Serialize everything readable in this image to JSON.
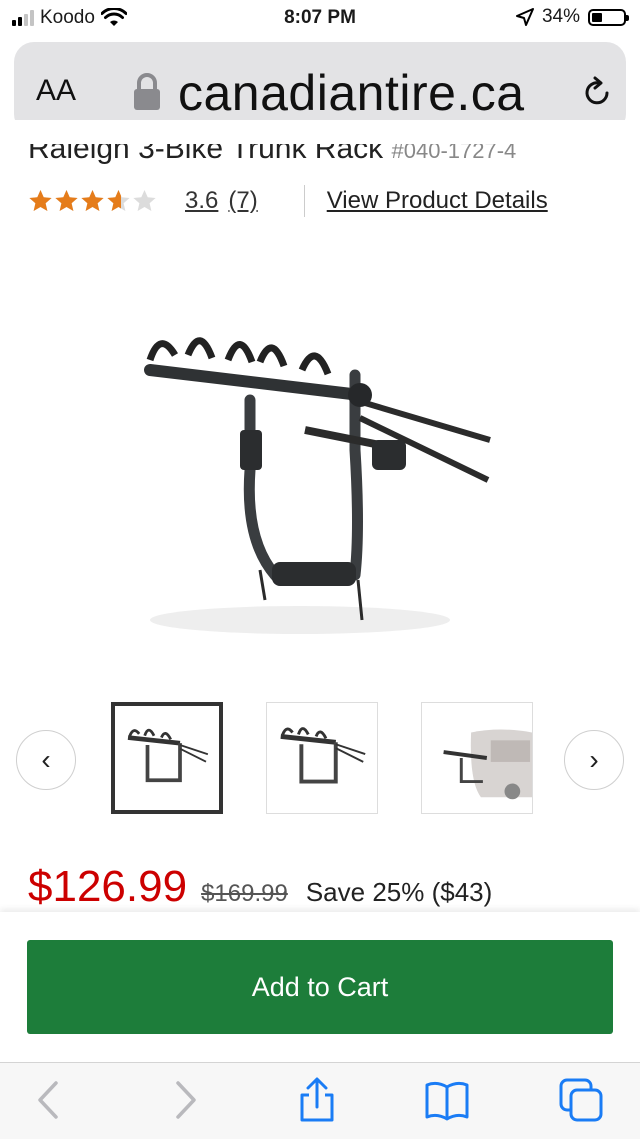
{
  "status_bar": {
    "carrier": "Koodo",
    "time": "8:07 PM",
    "battery_percent": "34%",
    "battery_level": 0.34,
    "signal_bars": 2,
    "icons": [
      "cellular-signal-icon",
      "wifi-icon",
      "location-arrow-icon",
      "battery-icon"
    ]
  },
  "browser": {
    "text_size_label": "AA",
    "domain": "canadiantire.ca",
    "icons": [
      "lock-icon",
      "reload-icon"
    ]
  },
  "product": {
    "title_partial": "Raleigh 3-Bike Trunk Rack",
    "sku_partial": "#040-1727-4",
    "rating_value": "3.6",
    "rating_stars": 3.6,
    "review_count": "(7)",
    "view_details_label": "View Product Details",
    "main_image_alt": "main-product-image"
  },
  "carousel": {
    "prev_label": "‹",
    "next_label": "›",
    "thumbnails": [
      {
        "name": "thumbnail-1",
        "selected": true
      },
      {
        "name": "thumbnail-2",
        "selected": false
      },
      {
        "name": "thumbnail-3",
        "selected": false
      }
    ]
  },
  "pricing": {
    "price": "$126.99",
    "was_price": "$169.99",
    "savings": "Save 25% ($43)"
  },
  "cart": {
    "add_to_cart_label": "Add to Cart"
  },
  "toolbar": {
    "icons": [
      "back-icon",
      "forward-icon",
      "share-icon",
      "bookmarks-icon",
      "tabs-icon"
    ]
  },
  "colors": {
    "price_red": "#cc0000",
    "cart_green": "#1d7d3a",
    "star_orange": "#e57c1a",
    "ios_blue": "#1a7cf5"
  }
}
